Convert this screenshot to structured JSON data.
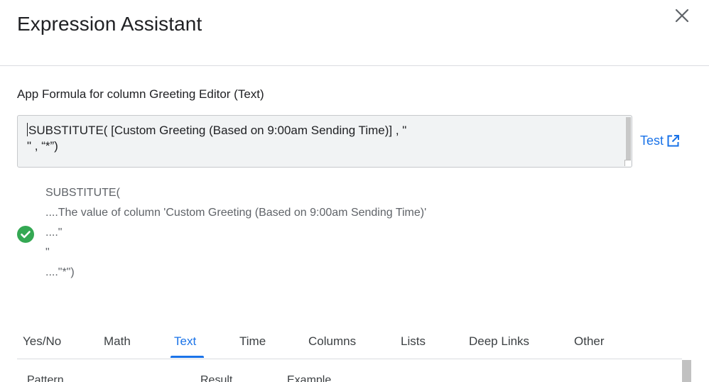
{
  "dialog": {
    "title": "Expression Assistant",
    "close_icon": "close-icon"
  },
  "formula": {
    "label": "App Formula for column Greeting Editor (Text)",
    "line1": "SUBSTITUTE( [Custom Greeting (Based on 9:00am Sending Time)] , \"",
    "line2": "\" , “*”)",
    "test_label": "Test",
    "test_icon": "open-in-new-icon"
  },
  "explanation": {
    "status_icon": "check-circle-icon",
    "status_color": "#34a853",
    "lines": [
      "SUBSTITUTE(",
      "....The value of column 'Custom Greeting (Based on 9:00am Sending Time)'",
      "....\"",
      "\"",
      "....\"*\")"
    ]
  },
  "tabs": {
    "active": "Text",
    "items": [
      "Yes/No",
      "Math",
      "Text",
      "Time",
      "Columns",
      "Lists",
      "Deep Links",
      "Other"
    ]
  },
  "table": {
    "headers": [
      "Pattern",
      "Result",
      "Example"
    ]
  }
}
